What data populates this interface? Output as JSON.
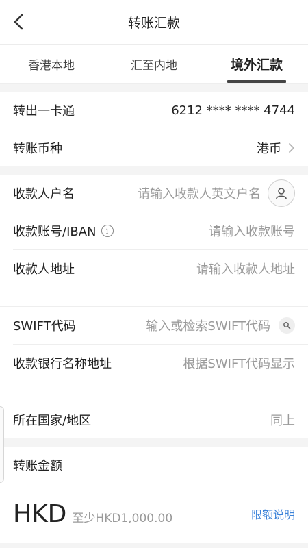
{
  "header": {
    "title": "转账汇款"
  },
  "tabs": [
    {
      "label": "香港本地",
      "active": false
    },
    {
      "label": "汇至内地",
      "active": false
    },
    {
      "label": "境外汇款",
      "active": true
    }
  ],
  "account": {
    "from_label": "转出一卡通",
    "from_value": "6212 **** **** 4744",
    "currency_label": "转账币种",
    "currency_value": "港币"
  },
  "payee": {
    "name_label": "收款人户名",
    "name_placeholder": "请输入收款人英文户名",
    "account_label": "收款账号/IBAN",
    "account_info_icon": "i",
    "account_placeholder": "请输入收款账号",
    "address_label": "收款人地址",
    "address_placeholder": "请输入收款人地址"
  },
  "bank": {
    "swift_label": "SWIFT代码",
    "swift_placeholder": "输入或检索SWIFT代码",
    "bank_label": "收款银行名称地址",
    "bank_placeholder": "根据SWIFT代码显示",
    "country_label": "所在国家/地区",
    "country_value": "同上"
  },
  "amount": {
    "label": "转账金额",
    "currency_code": "HKD",
    "min_hint": "至少HKD1,000.00",
    "limit_link": "限额说明"
  },
  "colors": {
    "accent": "#3b82d9",
    "placeholder": "#9a9a9a",
    "background": "#f4f4f4"
  }
}
